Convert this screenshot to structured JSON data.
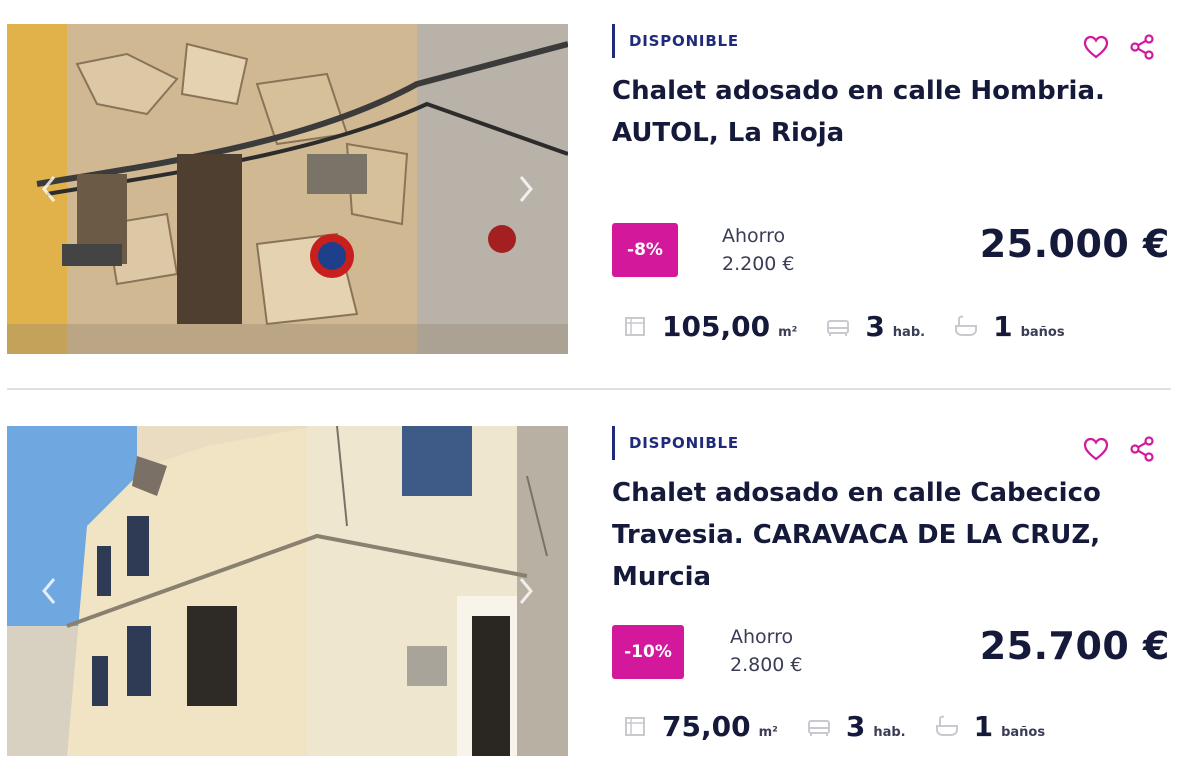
{
  "listings": [
    {
      "status": "DISPONIBLE",
      "title_line1": "Chalet adosado en calle Hombria.",
      "title_line2": "AUTOL, La Rioja",
      "title_line3": "",
      "discount": "-8%",
      "saving_label": "Ahorro",
      "saving_amount": "2.200 €",
      "price": "25.000 €",
      "area_value": "105,00",
      "area_unit": "m²",
      "rooms_value": "3",
      "rooms_unit": "hab.",
      "baths_value": "1",
      "baths_unit": "baños"
    },
    {
      "status": "DISPONIBLE",
      "title_line1": "Chalet adosado en calle Cabecico",
      "title_line2": "Travesia. CARAVACA DE LA CRUZ,",
      "title_line3": "Murcia",
      "discount": "-10%",
      "saving_label": "Ahorro",
      "saving_amount": "2.800 €",
      "price": "25.700 €",
      "area_value": "75,00",
      "area_unit": "m²",
      "rooms_value": "3",
      "rooms_unit": "hab.",
      "baths_value": "1",
      "baths_unit": "baños"
    }
  ],
  "icons": {
    "favorite": "heart-icon",
    "share": "share-icon",
    "area": "area-icon",
    "rooms": "bed-icon",
    "baths": "bathtub-icon",
    "prev": "chevron-left-icon",
    "next": "chevron-right-icon"
  },
  "colors": {
    "accent": "#d4189c",
    "status": "#1f2a7a",
    "text": "#161a3a"
  }
}
